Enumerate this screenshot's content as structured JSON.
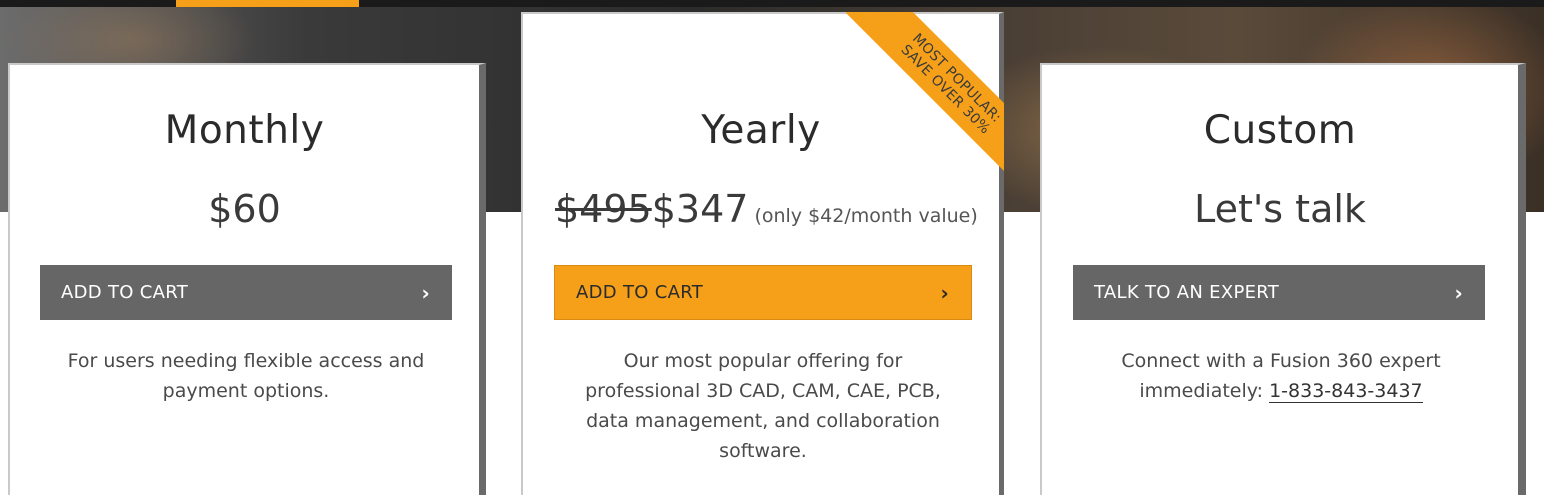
{
  "ribbon": {
    "line1": "MOST POPULAR:",
    "line2": "SAVE OVER 30%"
  },
  "plans": {
    "monthly": {
      "title": "Monthly",
      "price": "$60",
      "cta_label": "ADD TO CART",
      "description": "For users needing flexible access and payment options."
    },
    "yearly": {
      "title": "Yearly",
      "old_price": "$495",
      "price": "$347",
      "price_note": "(only $42/month value)",
      "cta_label": "ADD TO CART",
      "description": "Our most popular offering for professional 3D CAD, CAM, CAE, PCB, data management, and collaboration software."
    },
    "custom": {
      "title": "Custom",
      "price": "Let's talk",
      "cta_label": "TALK TO AN EXPERT",
      "description_prefix": "Connect with a Fusion 360 expert immediately:",
      "phone": "1-833-843-3437"
    }
  },
  "icons": {
    "cta_chevron": "chevron-right-icon"
  },
  "colors": {
    "accent": "#f6a01a",
    "button_gray": "#666666",
    "text_dark": "#2b2b2b"
  }
}
